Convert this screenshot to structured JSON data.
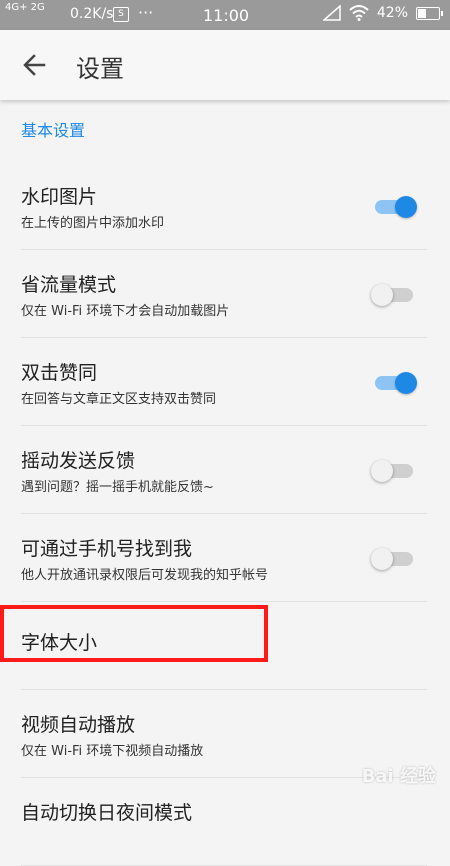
{
  "status_bar": {
    "network": "4G+ 2G",
    "speed": "0.2K/s",
    "s_icon": "S",
    "dots": "···",
    "time": "11:00",
    "battery": "42%",
    "battery_level": 0.42,
    "icons": [
      "signal-icon",
      "wifi-icon",
      "battery-icon"
    ]
  },
  "toolbar": {
    "title": "设置",
    "back_icon": "back-arrow-icon"
  },
  "section": {
    "title": "基本设置"
  },
  "settings": [
    {
      "title": "水印图片",
      "subtitle": "在上传的图片中添加水印",
      "enabled": true
    },
    {
      "title": "省流量模式",
      "subtitle": "仅在 Wi-Fi 环境下才会自动加载图片",
      "enabled": false
    },
    {
      "title": "双击赞同",
      "subtitle": "在回答与文章正文区支持双击赞同",
      "enabled": true
    },
    {
      "title": "摇动发送反馈",
      "subtitle": "遇到问题？摇一摇手机就能反馈~",
      "enabled": false
    },
    {
      "title": "可通过手机号找到我",
      "subtitle": "他人开放通讯录权限后可发现我的知乎帐号",
      "enabled": false
    },
    {
      "title": "字体大小"
    },
    {
      "title": "视频自动播放",
      "subtitle": "仅在 Wi-Fi 环境下视频自动播放"
    },
    {
      "title": "自动切换日夜间模式"
    }
  ],
  "watermark": "Bai 经验",
  "colors": {
    "accent": "#1e88e5",
    "highlight": "#ff1a1a",
    "status_bar": "#9a9a9a"
  }
}
